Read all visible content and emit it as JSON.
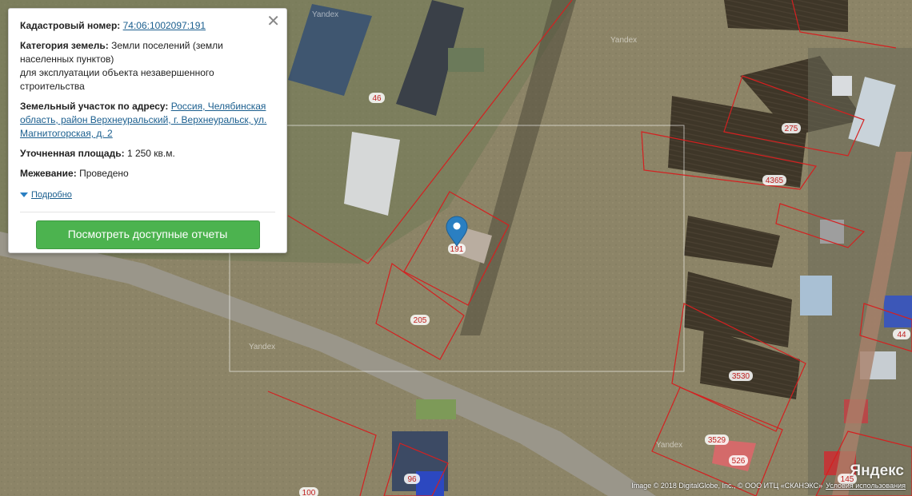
{
  "popup": {
    "cad_label": "Кадастровый номер:",
    "cad_value": "74:06:1002097:191",
    "cat_label": "Категория земель:",
    "cat_value_1": "Земли поселений (земли населенных пунктов)",
    "cat_value_2": "для эксплуатации объекта незавершенного строительства",
    "addr_label": "Земельный участок по адресу:",
    "addr_value": "Россия, Челябинская область, район Верхнеуральский, г. Верхнеуральск, ул. Магнитогорская, д. 2",
    "area_label": "Уточненная площадь:",
    "area_value": "1 250 кв.м.",
    "survey_label": "Межевание:",
    "survey_value": "Проведено",
    "more_link": "Подробно",
    "button": "Посмотреть доступные отчеты",
    "close_icon": "close-icon"
  },
  "map": {
    "watermark": "Yandex",
    "parcel_labels": {
      "p191": "191",
      "p205": "205",
      "p46": "46",
      "p275": "275",
      "p4365": "4365",
      "p3530": "3530",
      "p3529": "3529",
      "p526": "526",
      "p96": "96",
      "p100": "100",
      "p145": "145",
      "p44": "44"
    },
    "marker_icon": "map-pin-icon",
    "accent_color": "#2a7fc2",
    "parcel_line_color": "#d42020"
  },
  "footer": {
    "copyright": "Image © 2018 DigitalGlobe, Inc., © ООО ИТЦ «СКАНЭКС»",
    "terms_link": "Условия использования",
    "logo": "Яндекс"
  }
}
